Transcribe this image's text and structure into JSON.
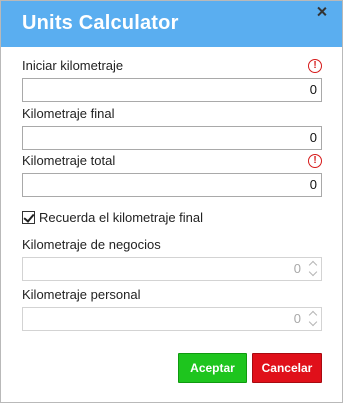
{
  "dialog": {
    "title": "Units Calculator"
  },
  "fields": {
    "start_label": "Iniciar kilometraje",
    "start_value": "0",
    "end_label": "Kilometraje final",
    "end_value": "0",
    "total_label": "Kilometraje total",
    "total_value": "0",
    "business_label": "Kilometraje de negocios",
    "business_value": "0",
    "personal_label": "Kilometraje personal",
    "personal_value": "0"
  },
  "warning_glyph": "!",
  "checkbox": {
    "label": "Recuerda el kilometraje final",
    "checked": true
  },
  "buttons": {
    "accept": "Aceptar",
    "cancel": "Cancelar"
  },
  "colors": {
    "titlebar": "#5aaef0",
    "accept": "#1ec51e",
    "cancel": "#e0101a",
    "warning": "#d61a1a"
  }
}
